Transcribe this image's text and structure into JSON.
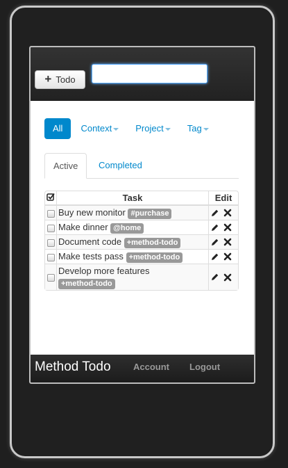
{
  "toolbar": {
    "add_button_label": "Todo",
    "add_icon": "plus-icon",
    "search_value": ""
  },
  "filters": [
    {
      "label": "All",
      "active": true,
      "dropdown": false
    },
    {
      "label": "Context",
      "active": false,
      "dropdown": true
    },
    {
      "label": "Project",
      "active": false,
      "dropdown": true
    },
    {
      "label": "Tag",
      "active": false,
      "dropdown": true
    }
  ],
  "tabs": [
    {
      "label": "Active",
      "active": true
    },
    {
      "label": "Completed",
      "active": false
    }
  ],
  "table": {
    "headers": {
      "check_icon": "check-square-icon",
      "task": "Task",
      "edit": "Edit"
    },
    "rows": [
      {
        "text": "Buy new monitor",
        "tag": "#purchase"
      },
      {
        "text": "Make dinner",
        "tag": "@home"
      },
      {
        "text": "Document code",
        "tag": "+method-todo"
      },
      {
        "text": "Make tests pass",
        "tag": "+method-todo"
      },
      {
        "text": "Develop more features",
        "tag": "+method-todo"
      }
    ]
  },
  "footer": {
    "brand": "Method Todo",
    "links": [
      "Account",
      "Logout"
    ]
  },
  "colors": {
    "accent": "#0088cc",
    "badge": "#999999",
    "bar": "#222222"
  }
}
